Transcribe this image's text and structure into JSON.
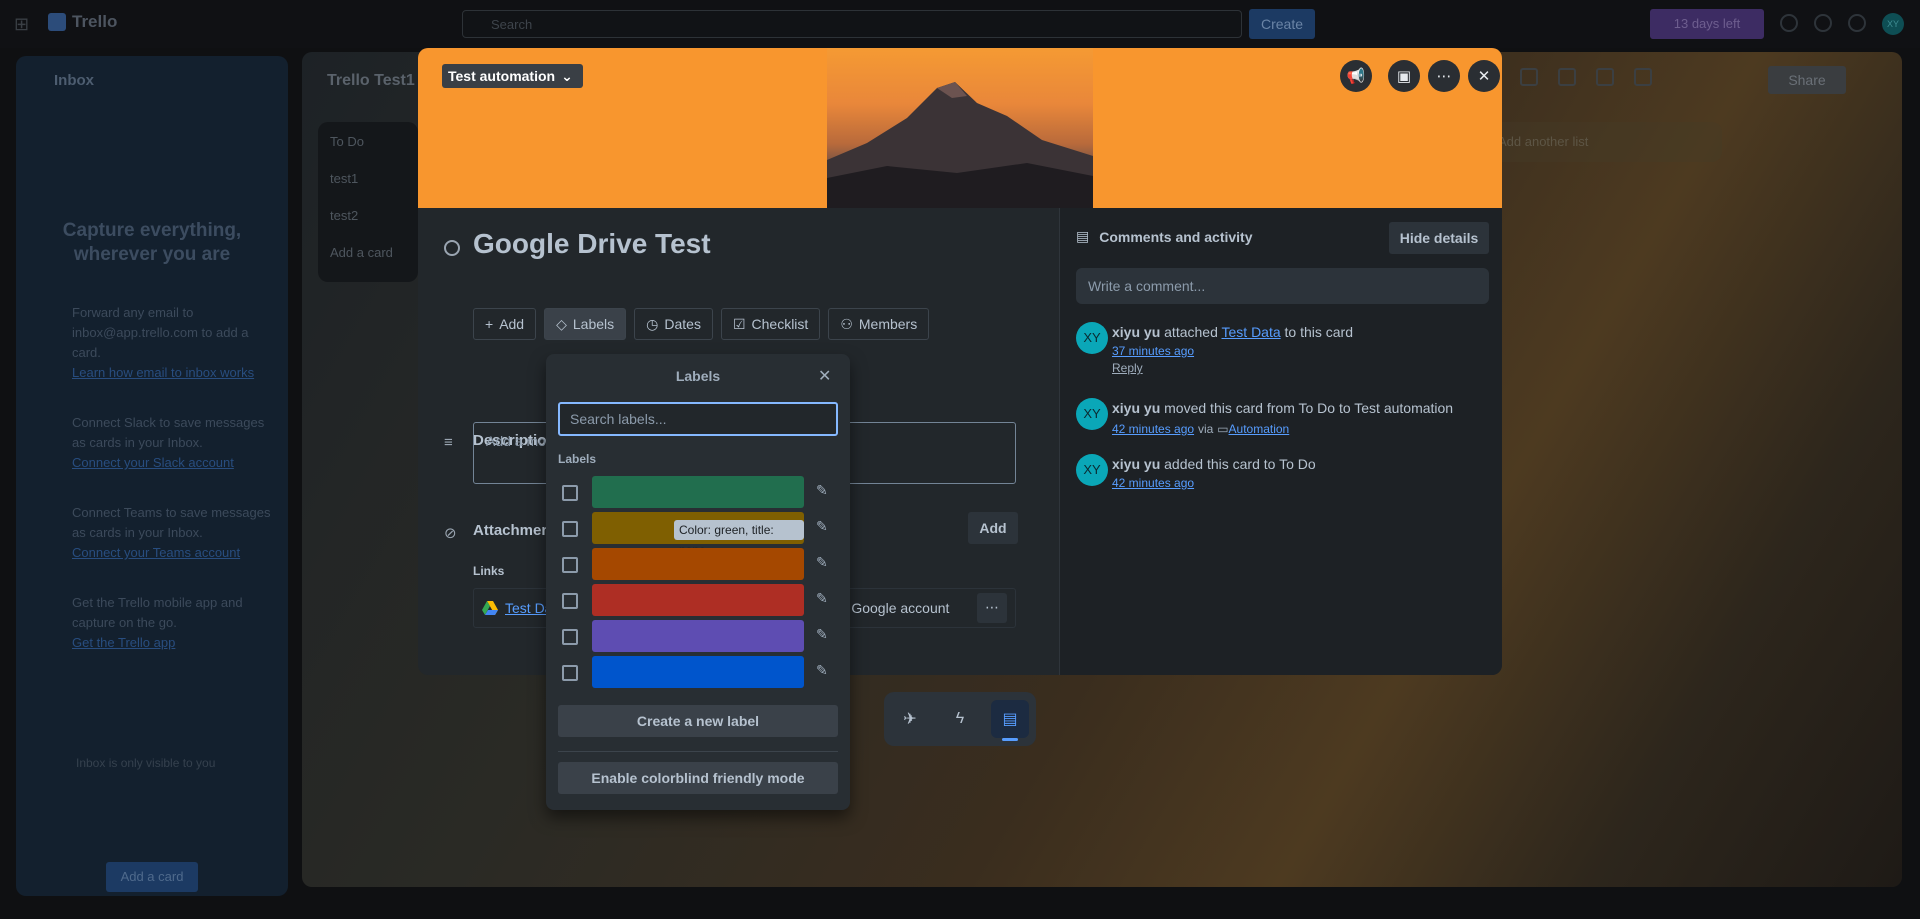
{
  "app": {
    "name": "Trello"
  },
  "topbar": {
    "search_placeholder": "Search",
    "create_label": "Create",
    "trial_label": "13 days left",
    "avatar_initials": "XY"
  },
  "inbox": {
    "title": "Inbox",
    "hero": "Capture everything, wherever you are",
    "tips": [
      {
        "text": "Forward any email to inbox@app.trello.com to add a card.",
        "link": "Learn how email to inbox works"
      },
      {
        "text": "Connect Slack to save messages as cards in your Inbox.",
        "link": "Connect your Slack account"
      },
      {
        "text": "Connect Teams to save messages as cards in your Inbox.",
        "link": "Connect your Teams account"
      },
      {
        "text": "Get the Trello mobile app and capture on the go.",
        "link": "Get the Trello app"
      }
    ],
    "private_note": "Inbox is only visible to you",
    "add_card": "Add a card"
  },
  "board": {
    "title": "Trello Test1",
    "list": {
      "title": "To Do",
      "cards": [
        "test1",
        "test2"
      ],
      "add": "Add a card"
    },
    "add_list": "Add another list",
    "share": "Share"
  },
  "card": {
    "list_name": "Test automation",
    "title": "Google Drive Test",
    "actions": {
      "add": "Add",
      "labels": "Labels",
      "dates": "Dates",
      "checklist": "Checklist",
      "members": "Members"
    },
    "description": {
      "title": "Description",
      "placeholder": "Add a more detailed description..."
    },
    "attachments": {
      "title": "Attachments",
      "add": "Add"
    },
    "links": {
      "label": "Links",
      "item": "Test Data",
      "right_text": "ur Google account"
    }
  },
  "activity": {
    "title": "Comments and activity",
    "hide": "Hide details",
    "comment_placeholder": "Write a comment...",
    "items": [
      {
        "initials": "XY",
        "user": "xiyu yu",
        "pre": "attached",
        "link": "Test Data",
        "post": "to this card",
        "time": "37 minutes ago",
        "reply": "Reply"
      },
      {
        "initials": "XY",
        "user": "xiyu yu",
        "pre": "moved this card from To Do to Test automation",
        "time": "42 minutes ago",
        "via": "via",
        "via_link": "Automation"
      },
      {
        "initials": "XY",
        "user": "xiyu yu",
        "pre": "added this card to To Do",
        "time": "42 minutes ago"
      }
    ]
  },
  "labels_popover": {
    "title": "Labels",
    "search_placeholder": "Search labels...",
    "subtitle": "Labels",
    "labels": [
      {
        "color": "#216e4e",
        "name": ""
      },
      {
        "color": "#7f5f01",
        "name": ""
      },
      {
        "color": "#a54800",
        "name": ""
      },
      {
        "color": "#ae2e24",
        "name": ""
      },
      {
        "color": "#5e4db2",
        "name": ""
      },
      {
        "color": "#0055cc",
        "name": ""
      }
    ],
    "tooltip": "Color: green, title: none",
    "create": "Create a new label",
    "colorblind": "Enable colorblind friendly mode"
  },
  "colors": {
    "cover": "#f8962e",
    "accent": "#579dff",
    "avatar": "#0aa7b8"
  }
}
